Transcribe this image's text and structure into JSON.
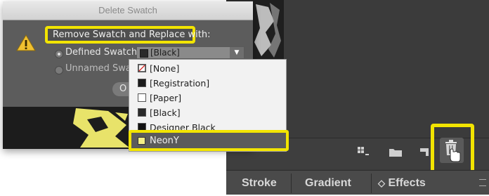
{
  "dialog": {
    "title": "Delete Swatch",
    "heading": "Remove Swatch and Replace with:",
    "defined_label": "Defined Swatch:",
    "unnamed_label": "Unnamed Swatch",
    "selected_value": "[Black]",
    "ok_stub": "O",
    "warning_icon": "warning-triangle-icon"
  },
  "dropdown": {
    "items": [
      {
        "label": "[None]",
        "swatch": "none"
      },
      {
        "label": "[Registration]",
        "swatch": "#1b1b1b"
      },
      {
        "label": "[Paper]",
        "swatch": "#ffffff"
      },
      {
        "label": "[Black]",
        "swatch": "#2a2a2a"
      },
      {
        "label": "Designer Black",
        "swatch": "#121212"
      }
    ],
    "highlighted": {
      "label": "NeonY",
      "swatch": "#f4ef86"
    }
  },
  "panel": {
    "tabs": [
      {
        "label": "Stroke"
      },
      {
        "label": "Gradient"
      },
      {
        "label": "Effects",
        "prefix": "◇"
      }
    ],
    "buttons": [
      "grid-icon",
      "folder-icon",
      "new-swatch-icon",
      "trash-icon"
    ]
  },
  "colors": {
    "highlight": "#f2e400",
    "panel_bg": "#3b3b3b",
    "dialog_bg": "#5c5c5c"
  }
}
